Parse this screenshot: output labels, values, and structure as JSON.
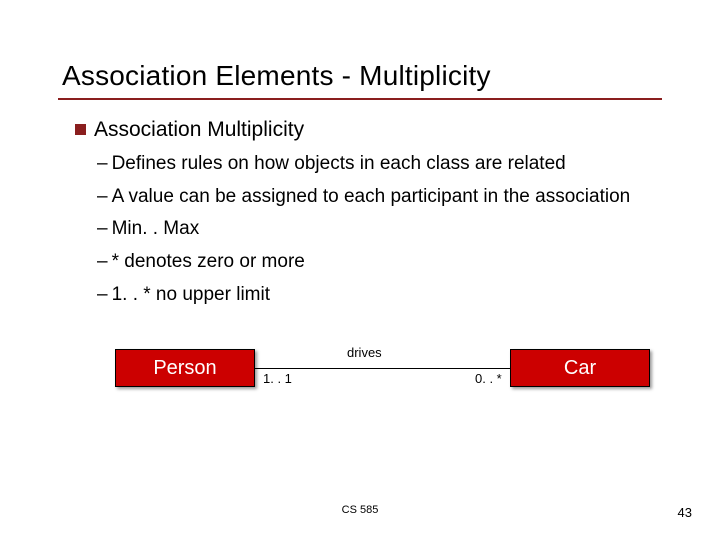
{
  "title": "Association Elements - Multiplicity",
  "section": {
    "heading": "Association Multiplicity",
    "points": [
      "Defines rules on how objects in each class are related",
      "A value can be assigned to each participant in the association",
      "Min. . Max",
      "* denotes zero or more",
      "1. . * no upper limit"
    ]
  },
  "diagram": {
    "left_class": "Person",
    "right_class": "Car",
    "association_label": "drives",
    "multiplicity_left": "1. . 1",
    "multiplicity_right": "0. . *"
  },
  "footer": {
    "course": "CS 585",
    "page": "43"
  }
}
